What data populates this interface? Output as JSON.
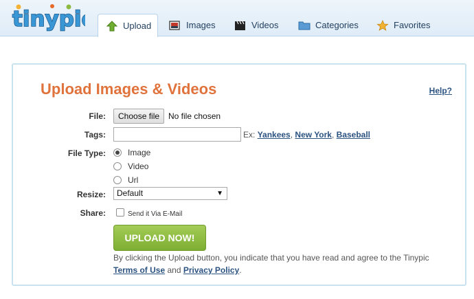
{
  "header": {
    "logo_text": "tinypic",
    "tabs": [
      {
        "label": "Upload",
        "icon": "upload-arrow-icon",
        "active": true
      },
      {
        "label": "Images",
        "icon": "image-icon",
        "active": false
      },
      {
        "label": "Videos",
        "icon": "clapperboard-icon",
        "active": false
      },
      {
        "label": "Categories",
        "icon": "folder-icon",
        "active": false
      },
      {
        "label": "Favorites",
        "icon": "star-icon",
        "active": false
      }
    ]
  },
  "main": {
    "title": "Upload Images & Videos",
    "help_link": "Help?",
    "file": {
      "label": "File:",
      "button": "Choose file",
      "status": "No file chosen"
    },
    "tags": {
      "label": "Tags:",
      "value": "",
      "example_prefix": "Ex:",
      "examples": [
        "Yankees",
        "New York",
        "Baseball"
      ]
    },
    "file_type": {
      "label": "File Type:",
      "options": [
        {
          "label": "Image",
          "checked": true
        },
        {
          "label": "Video",
          "checked": false
        },
        {
          "label": "Url",
          "checked": false
        }
      ]
    },
    "resize": {
      "label": "Resize:",
      "selected": "Default",
      "arrow": "▼"
    },
    "share": {
      "label": "Share:",
      "option": "Send it Via E-Mail",
      "checked": false
    },
    "upload_button": "UPLOAD NOW!",
    "agreement": {
      "text": "By clicking the Upload button, you indicate that you have read and agree to the Tinypic",
      "terms": "Terms of Use",
      "and": "and",
      "privacy": "Privacy Policy",
      "period": "."
    }
  },
  "colors": {
    "accent_orange": "#e0723c",
    "link_blue": "#2b5280",
    "button_green": "#8dbb42",
    "panel_border": "#c8e2f0",
    "header_bg": "#e6f0f9"
  }
}
